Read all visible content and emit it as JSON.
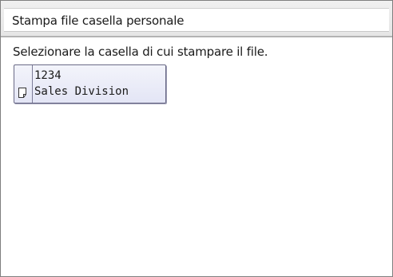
{
  "header": {
    "title": "Stampa file casella personale"
  },
  "main": {
    "instruction": "Selezionare la casella di cui stampare il file.",
    "boxes": [
      {
        "number": "1234",
        "name": "Sales Division",
        "icon": "document-icon"
      }
    ]
  },
  "colors": {
    "button_fill": "#e3e5f5",
    "button_border": "#6a6a86",
    "header_rule": "#b3b3b3"
  }
}
